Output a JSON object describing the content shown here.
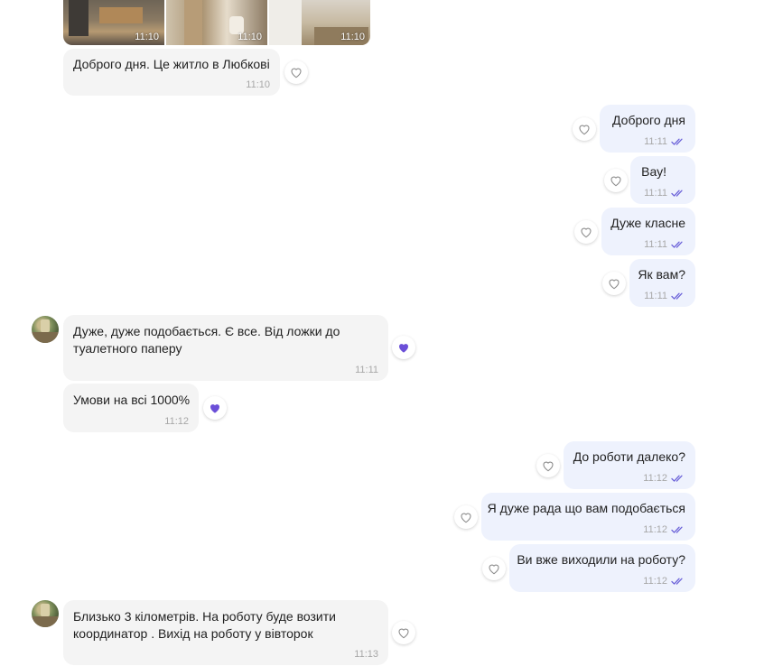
{
  "photos": [
    {
      "time": "11:10"
    },
    {
      "time": "11:10"
    },
    {
      "time": "11:10"
    }
  ],
  "messages": [
    {
      "text": "Доброго дня. Це житло в Любкові",
      "time": "11:10"
    },
    {
      "text": "Доброго дня",
      "time": "11:11"
    },
    {
      "text": "Вау!",
      "time": "11:11"
    },
    {
      "text": "Дуже класне",
      "time": "11:11"
    },
    {
      "text": "Як вам?",
      "time": "11:11"
    },
    {
      "line1": "Дуже, дуже подобається. Є все. Від ложки до",
      "line2": "туалетного паперу",
      "time": "11:11"
    },
    {
      "text": "Умови на всі 1000%",
      "time": "11:12"
    },
    {
      "text": "До роботи далеко?",
      "time": "11:12"
    },
    {
      "text": "Я дуже рада що вам подобається",
      "time": "11:12"
    },
    {
      "text": "Ви вже виходили на роботу?",
      "time": "11:12"
    },
    {
      "line1": "Близько 3 кілометрів. На роботу буде возити",
      "line2": "координатор . Вихід на роботу у вівторок",
      "time": "11:13"
    }
  ],
  "colors": {
    "incoming_bubble": "#f4f4f4",
    "outgoing_bubble": "#eef2fd",
    "read_ticks": "#6c63d9",
    "liked_heart": "#6b4fd8"
  },
  "icons": {
    "reaction_empty": "heart-outline-icon",
    "reaction_liked": "heart-filled-icon",
    "read_status": "double-check-icon"
  }
}
